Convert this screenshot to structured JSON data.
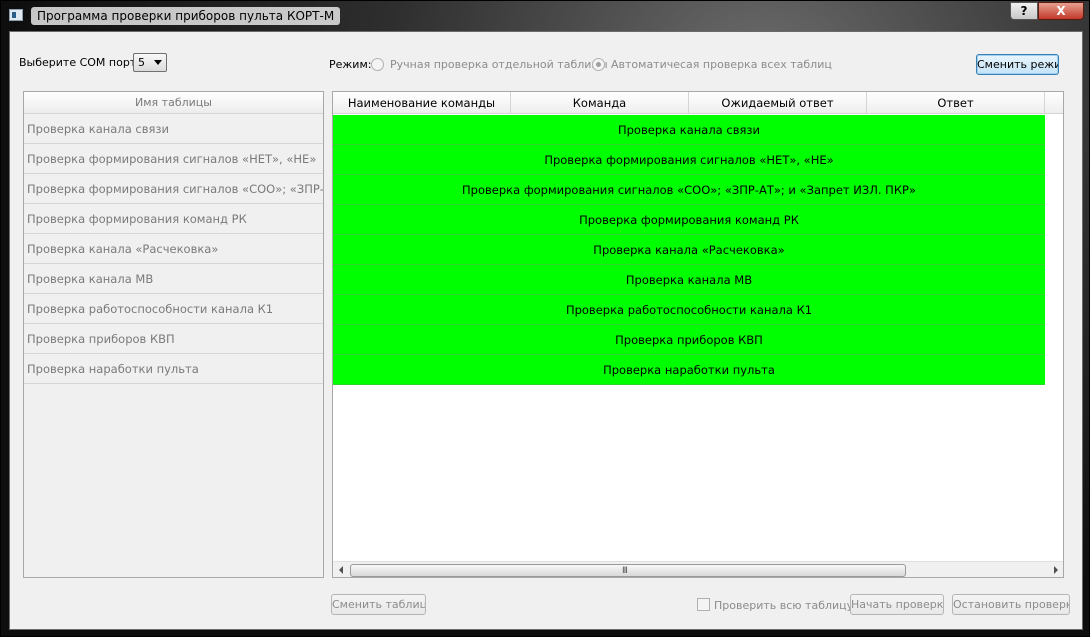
{
  "window": {
    "title": "Программа проверки приборов пульта КОРТ-М",
    "help_label": "?",
    "close_label": "X"
  },
  "com": {
    "label": "Выберите COM порт:",
    "selected": "5"
  },
  "mode": {
    "label": "Режим:",
    "manual_label": "Ручная проверка отдельной таблицы",
    "auto_label": "Автоматичесая проверка всех таблиц",
    "selected": "auto",
    "change_button": "Сменить режим"
  },
  "left_list": {
    "header": "Имя таблицы",
    "items": [
      "Проверка канала связи",
      "Проверка формирования сигналов «НЕТ», «НЕ»",
      "Проверка формирования сигналов «СОО»; «ЗПР-...",
      "Проверка формирования команд РК",
      "Проверка канала «Расчековка»",
      "Проверка канала МВ",
      "Проверка работоспособности канала К1",
      "Проверка приборов КВП",
      "Проверка наработки пульта"
    ]
  },
  "table": {
    "columns": [
      "Наименование команды",
      "Команда",
      "Ожидаемый ответ",
      "Ответ"
    ],
    "rows": [
      "Проверка канала связи",
      "Проверка формирования сигналов «НЕТ», «НЕ»",
      "Проверка формирования сигналов «СОО»; «ЗПР-АТ»; и «Запрет ИЗЛ. ПКР»",
      "Проверка формирования команд РК",
      "Проверка канала «Расчековка»",
      "Проверка канала МВ",
      "Проверка работоспособности канала К1",
      "Проверка приборов КВП",
      "Проверка наработки пульта"
    ],
    "row_color": "#00ff00",
    "scroll_grip": "III"
  },
  "bottom": {
    "change_table": "Сменить таблицу",
    "check_all_label": "Проверить всю таблицу",
    "start": "Начать проверку",
    "stop": "Остановить проверку"
  }
}
